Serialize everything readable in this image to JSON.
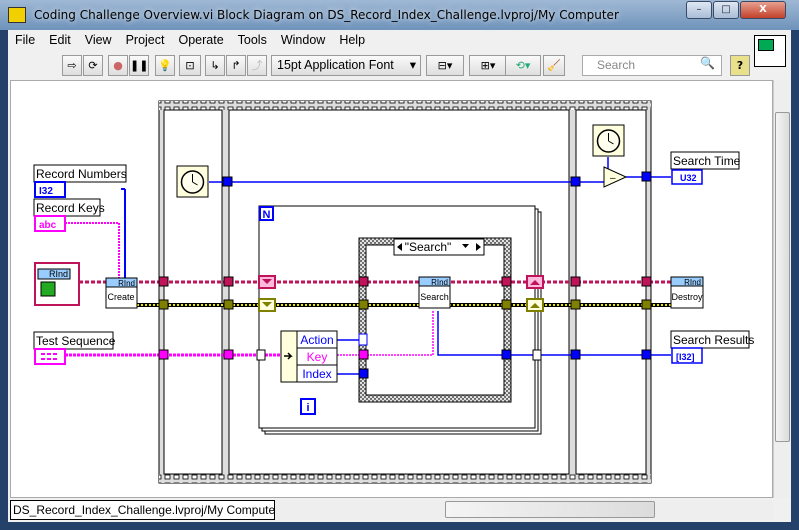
{
  "window": {
    "title": "Coding Challenge Overview.vi Block Diagram on DS_Record_Index_Challenge.lvproj/My Computer",
    "minimize": "–",
    "maximize": "□",
    "close": "X"
  },
  "menu": [
    "File",
    "Edit",
    "View",
    "Project",
    "Operate",
    "Tools",
    "Window",
    "Help"
  ],
  "toolbar": {
    "font": "15pt Application Font",
    "search_placeholder": "Search",
    "help": "?"
  },
  "diagram": {
    "controls": {
      "record_numbers": {
        "label": "Record Numbers",
        "type": "I32"
      },
      "record_keys": {
        "label": "Record Keys",
        "type": "abc"
      },
      "test_sequence": {
        "label": "Test Sequence",
        "type": "[cluster]"
      }
    },
    "indicators": {
      "search_time": {
        "label": "Search Time",
        "type": "U32"
      },
      "search_results": {
        "label": "Search Results",
        "type": "[I32]"
      }
    },
    "class_constant": {
      "header": "RInd"
    },
    "nodes": {
      "create": {
        "header": "RInd",
        "label": "Create"
      },
      "search": {
        "header": "RInd",
        "label": "Search"
      },
      "destroy": {
        "header": "RInd",
        "label": "Destroy"
      }
    },
    "for_loop": {
      "count": "N",
      "iteration": "i"
    },
    "case_selector": "\"Search\"",
    "unbundle": [
      "Action",
      "Key",
      "Index"
    ],
    "subtract": "–"
  },
  "statusbar": {
    "context": "DS_Record_Index_Challenge.lvproj/My Computer"
  },
  "colors": {
    "class_wire": "#c0145a",
    "error_wire": "#b8b800",
    "int_wire": "#0000ff",
    "string_wire": "#ff00ff"
  }
}
